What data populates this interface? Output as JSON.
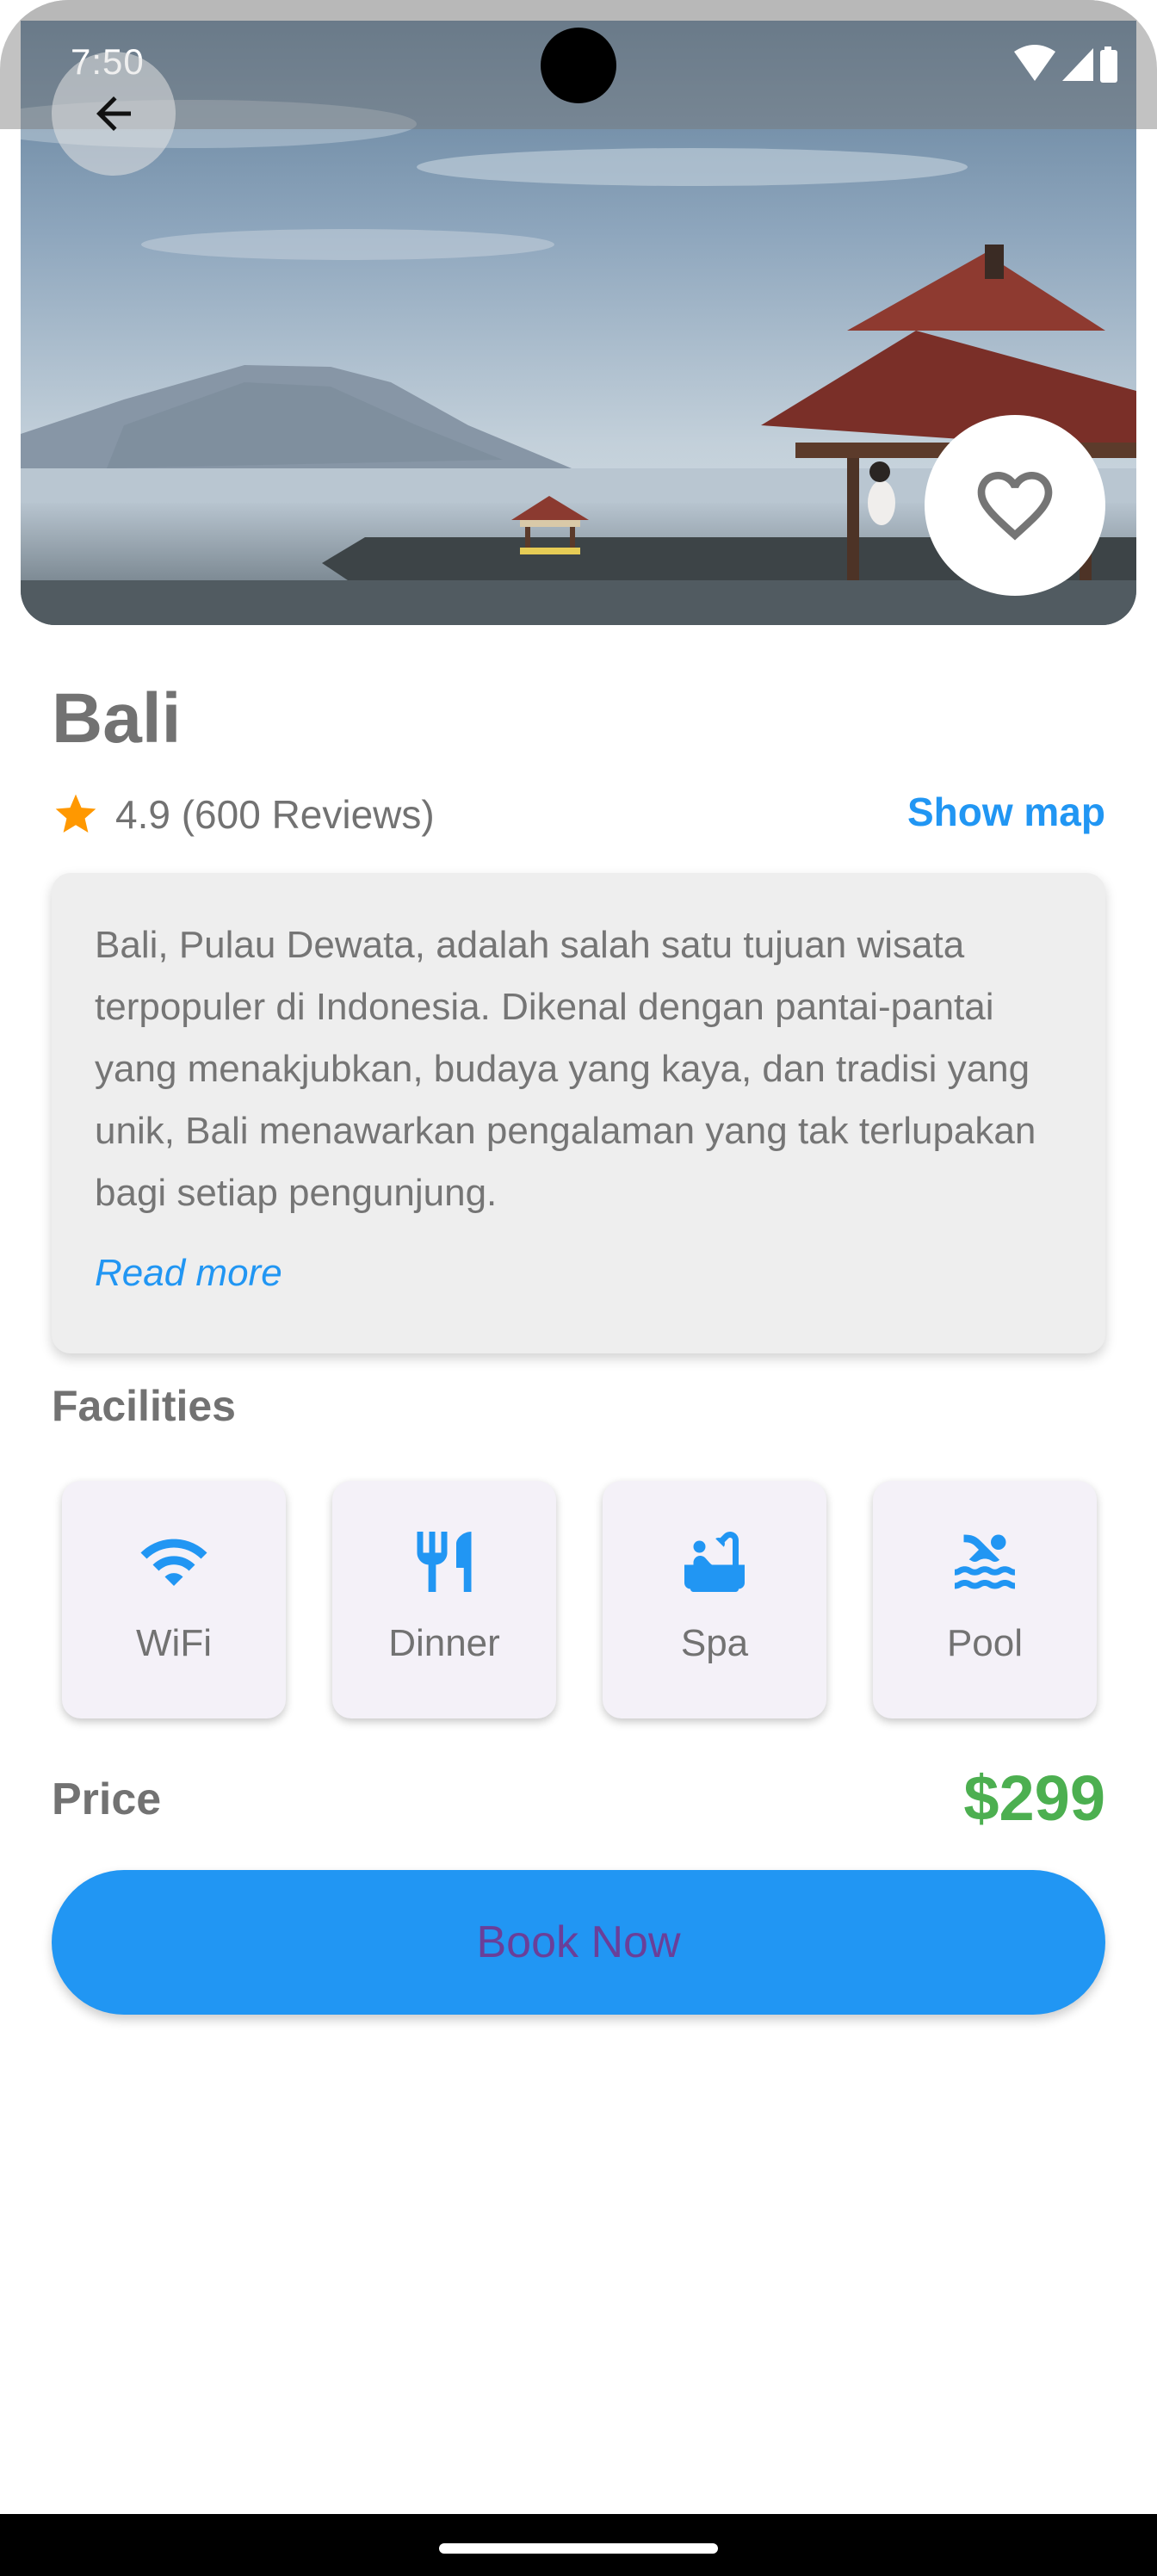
{
  "status_bar": {
    "time": "7:50",
    "icons": [
      "wifi-icon",
      "signal-icon",
      "battery-icon"
    ]
  },
  "header": {
    "back_icon": "arrow-back-icon",
    "favorite_icon": "heart-outline-icon"
  },
  "destination": {
    "name": "Bali",
    "rating_text": "4.9 (600 Reviews)",
    "show_map_label": "Show map",
    "description": "Bali, Pulau Dewata, adalah salah satu tujuan wisata terpopuler di Indonesia. Dikenal dengan pantai-pantai yang menakjubkan, budaya yang kaya, dan tradisi yang unik, Bali menawarkan pengalaman yang tak terlupakan bagi setiap pengunjung.",
    "read_more_label": "Read more"
  },
  "facilities": {
    "title": "Facilities",
    "items": [
      {
        "label": "WiFi",
        "icon": "wifi-icon"
      },
      {
        "label": "Dinner",
        "icon": "restaurant-icon"
      },
      {
        "label": "Spa",
        "icon": "bathtub-icon"
      },
      {
        "label": "Pool",
        "icon": "pool-icon"
      }
    ]
  },
  "price": {
    "label": "Price",
    "value": "$299"
  },
  "booking": {
    "button_label": "Book Now"
  },
  "colors": {
    "accent": "#2196f3",
    "price": "#4caf50",
    "button_text": "#6a3f99",
    "star": "#ff9800",
    "text_gray": "#727272"
  }
}
